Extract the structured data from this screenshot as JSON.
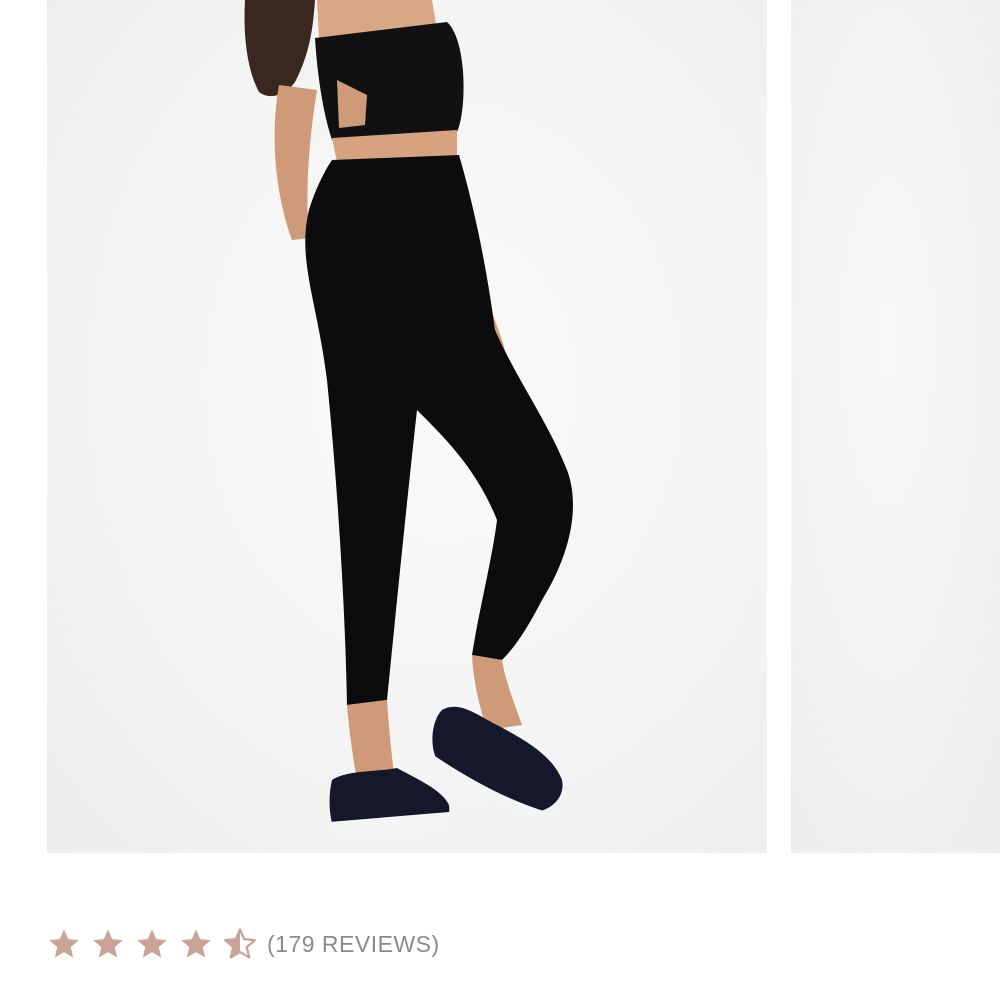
{
  "rating": {
    "value": 4.5,
    "max": 5,
    "reviews_text": "(179 REVIEWS)",
    "star_color": "#c9a396"
  },
  "gallery": {
    "main_image": "product-photo-model-black-leggings",
    "next_image": "product-photo-next"
  }
}
